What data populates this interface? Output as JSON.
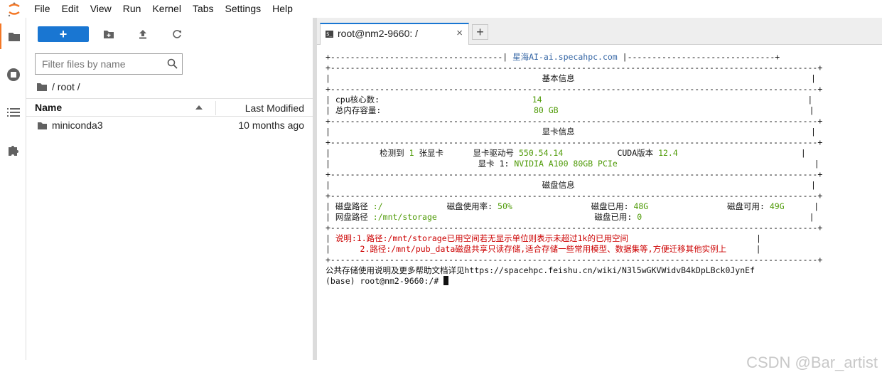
{
  "menu": {
    "items": [
      "File",
      "Edit",
      "View",
      "Run",
      "Kernel",
      "Tabs",
      "Settings",
      "Help"
    ]
  },
  "sidebar": {
    "icons": [
      "folder-icon",
      "running-icon",
      "toc-icon",
      "extension-icon"
    ]
  },
  "filebrowser": {
    "new_label": "+",
    "filter_placeholder": "Filter files by name",
    "breadcrumb": "/ root /",
    "col_name": "Name",
    "col_modified": "Last Modified",
    "files": [
      {
        "name": "miniconda3",
        "modified": "10 months ago"
      }
    ]
  },
  "tab": {
    "title": "root@nm2-9660: /",
    "close": "×",
    "add": "+"
  },
  "terminal": {
    "brand": "星海AI-ai.specahpc.com",
    "basic_title": "基本信息",
    "cpu_label": "cpu核心数:",
    "cpu_value": "14",
    "mem_label": "总内存容量:",
    "mem_value": "80 GB",
    "gpu_title": "显卡信息",
    "gpu_detect_a": "检测到 ",
    "gpu_count": "1",
    "gpu_detect_b": " 张显卡",
    "driver_label": "显卡驱动号 ",
    "driver_value": "550.54.14",
    "cuda_label": "CUDA版本 ",
    "cuda_value": "12.4",
    "gpu_name_label": "显卡 1: ",
    "gpu_name": "NVIDIA A100 80GB PCIe",
    "disk_title": "磁盘信息",
    "disk_path_label": "磁盘路径 ",
    "disk_path": ":/",
    "disk_usage_label": "磁盘使用率: ",
    "disk_usage": "50%",
    "disk_used_label": "磁盘已用: ",
    "disk_used": "48G",
    "disk_free_label": "磁盘可用: ",
    "disk_free": "49G",
    "net_path_label": "网盘路径 ",
    "net_path": ":/mnt/storage",
    "net_used_label": "磁盘已用: ",
    "net_used": "0",
    "note1": "说明:1.路径:/mnt/storage已用空间若无显示单位则表示未超过1k的已用空间",
    "note2": "2.路径:/mnt/pub_data磁盘共享只读存储,适合存储一些常用模型、数据集等,方便迁移其他实例上",
    "doc_line": "公共存储使用说明及更多帮助文档详见https://spacehpc.feishu.cn/wiki/N3l5wGKVWidvB4kDpLBck0JynEf",
    "prompt": "(base) root@nm2-9660:/# "
  },
  "watermark": "CSDN @Bar_artist",
  "colors": {
    "accent": "#1976d2",
    "logo": "#f37726",
    "term_green": "#4e9a06",
    "term_red": "#cc0000",
    "term_blue": "#3465a4"
  }
}
